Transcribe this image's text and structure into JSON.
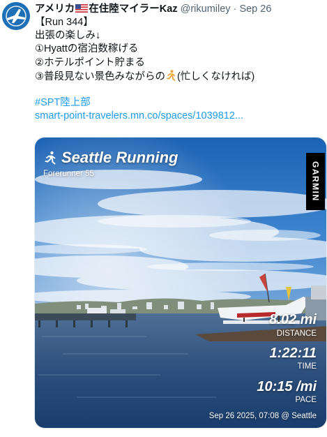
{
  "tweet": {
    "author": {
      "display_name": "アメリカ",
      "display_name_suffix": "在住陸マイラーKaz",
      "flag_icon": "us-flag-icon",
      "handle": "@rikumiley",
      "separator": "·",
      "date": "Sep 26"
    },
    "lines": [
      "【Run 344】",
      "出張の楽しみ↓",
      "①Hyattの宿泊数稼げる",
      "②ホテルポイント貯まる"
    ],
    "line5_text": "③普段見ない景色みながらの",
    "line5_icon": "woman-running-icon",
    "line5_suffix": "(忙しくなければ)",
    "hashtag": "#SPT陸上部",
    "url": "smart-point-travelers.mn.co/spaces/1039812..."
  },
  "media": {
    "title": "Seattle Running",
    "title_icon": "runner-icon",
    "device": "Forerunner 55",
    "brand": "GARMIN",
    "stats": [
      {
        "value": "8.02 mi",
        "label": "DISTANCE"
      },
      {
        "value": "1:22:11",
        "label": "TIME"
      },
      {
        "value": "10:15 /mi",
        "label": "PACE"
      }
    ],
    "footer": "Sep 26 2025, 07:08 @ Seattle"
  }
}
